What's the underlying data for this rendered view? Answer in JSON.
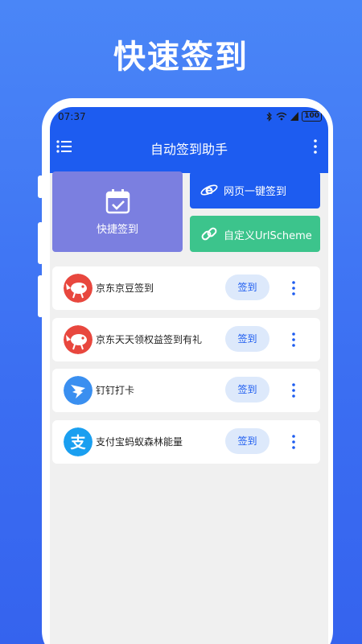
{
  "promo": {
    "title": "快速签到"
  },
  "status": {
    "time": "07:37",
    "battery": "100"
  },
  "appbar": {
    "title": "自动签到助手"
  },
  "tiles": {
    "quick": "快捷签到",
    "web": "网页一键签到",
    "url": "自定义UrlScheme"
  },
  "items": [
    {
      "name": "京东京豆签到",
      "button": "签到",
      "logo_color": "#e8473e"
    },
    {
      "name": "京东天天领权益签到有礼",
      "button": "签到",
      "logo_color": "#e8473e"
    },
    {
      "name": "钉钉打卡",
      "button": "签到",
      "logo_color": "#3a8ff0"
    },
    {
      "name": "支付宝蚂蚁森林能量",
      "button": "签到",
      "logo_color": "#1a9ff0"
    }
  ],
  "alipay_glyph": "支",
  "colors": {
    "primary": "#1d5cf0",
    "quick_tile": "#7b7fe0",
    "url_tile": "#3cc48c",
    "button_bg": "#dde9fb"
  }
}
